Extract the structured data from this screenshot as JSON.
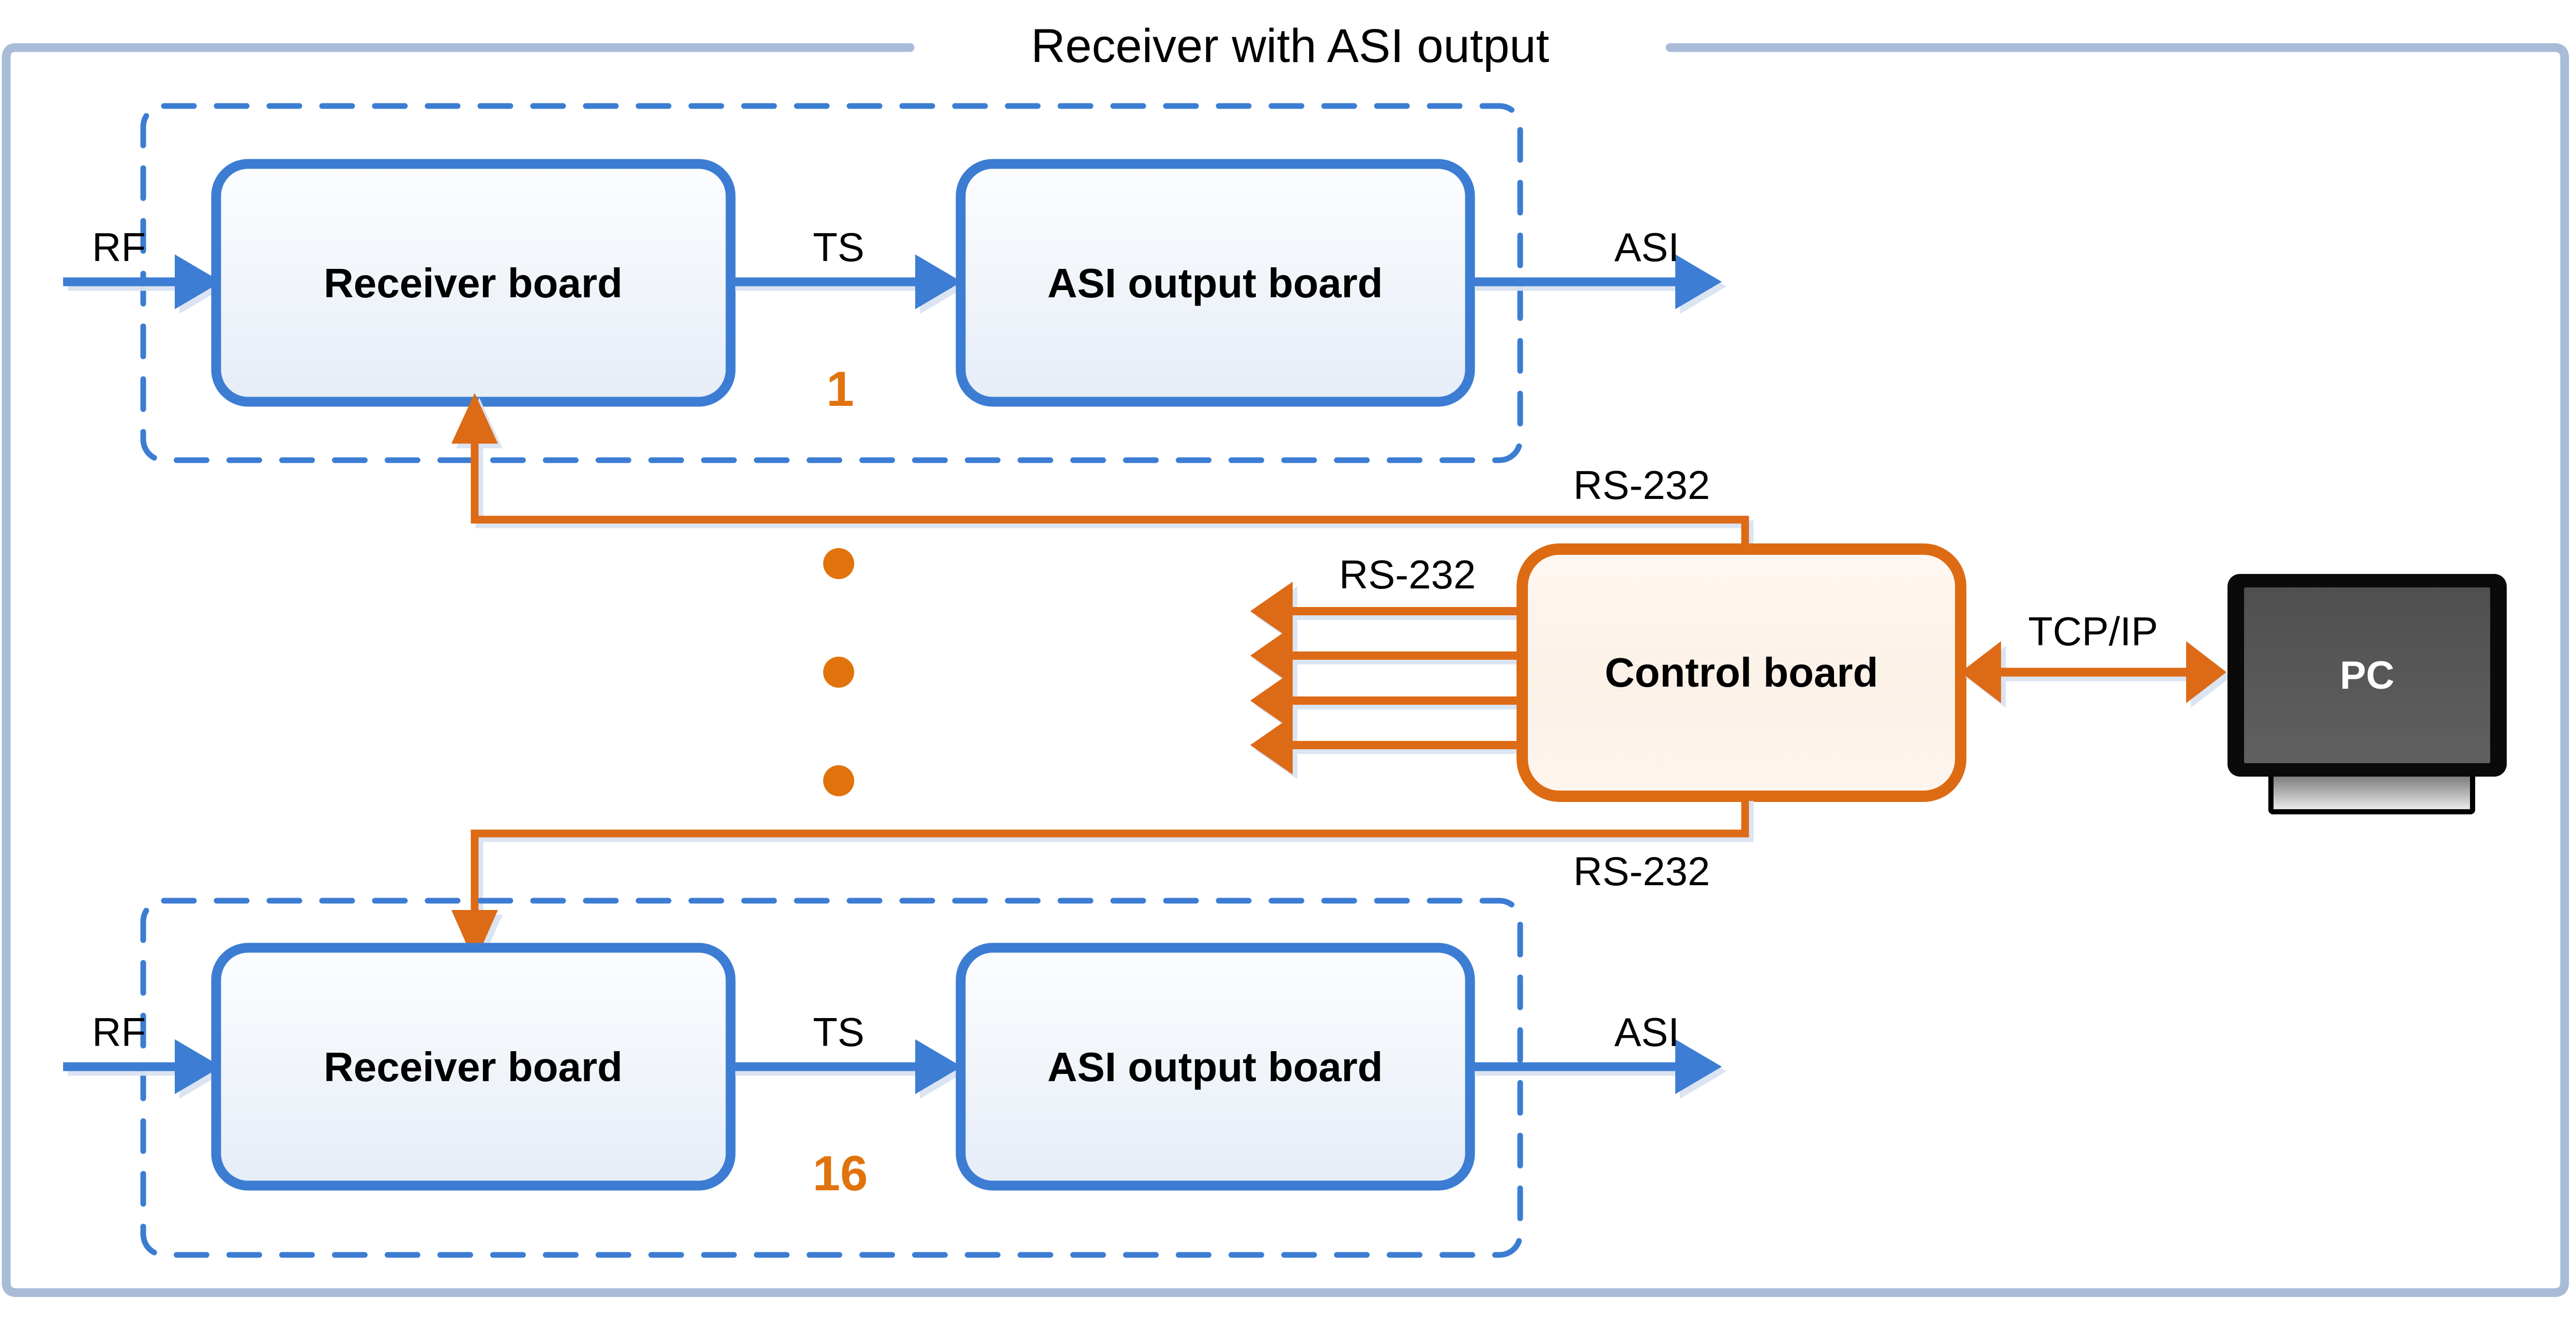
{
  "diagram": {
    "title": "Receiver with ASI output",
    "colors": {
      "outer_frame": "#A8BCD8",
      "board_border": "#3C7DD3",
      "board_fill_top": "#FBFCFE",
      "board_fill_bottom": "#E8EEF7",
      "dashed_group": "#3C7DD3",
      "control_border": "#DD6B13",
      "control_fill": "#FDF3EC",
      "signal_blue": "#3C7DD3",
      "signal_orange": "#DD6B13",
      "index_orange": "#E1730C",
      "pc_bezel": "#000000",
      "pc_screen": "#575757",
      "pc_stand": "#BEBEBE",
      "text": "#000000"
    },
    "chains": [
      {
        "index_label": "1",
        "input_label": "RF",
        "receiver_board": "Receiver board",
        "link_label": "TS",
        "output_board": "ASI output board",
        "output_label": "ASI",
        "control_link_label": "RS-232"
      },
      {
        "index_label": "16",
        "input_label": "RF",
        "receiver_board": "Receiver board",
        "link_label": "TS",
        "output_board": "ASI output board",
        "output_label": "ASI",
        "control_link_label": "RS-232"
      }
    ],
    "ellipsis": {
      "dot_count": 3,
      "meaning": "chains 2 through 15 omitted"
    },
    "control": {
      "label": "Control board",
      "bus_label": "RS-232",
      "bus_arrow_count": 4
    },
    "host": {
      "label": "PC",
      "link_label": "TCP/IP"
    }
  }
}
